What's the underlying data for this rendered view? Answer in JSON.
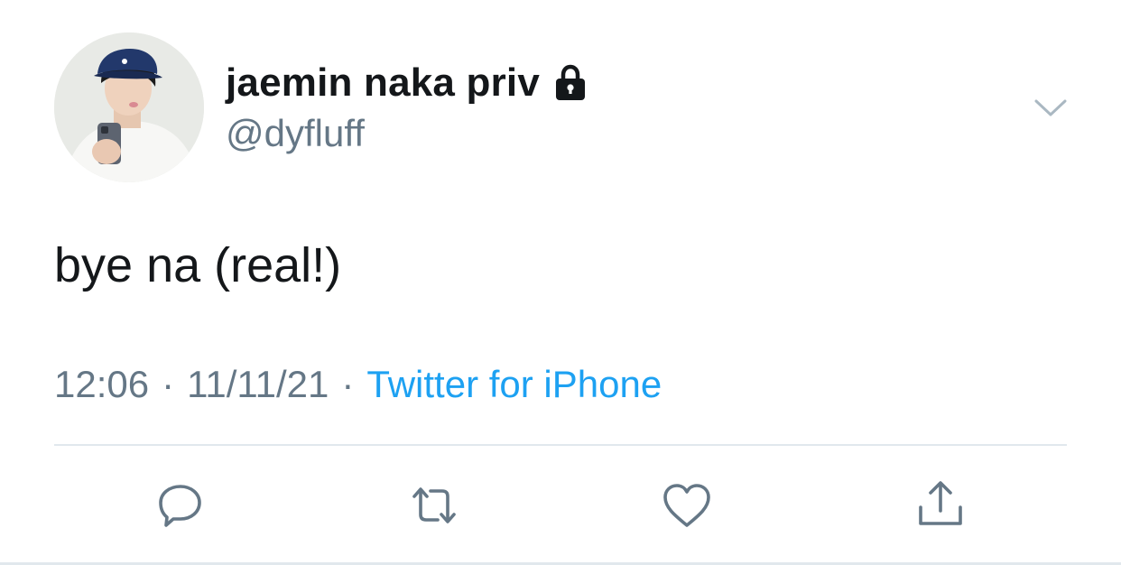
{
  "user": {
    "display_name": "jaemin naka priv",
    "handle": "@dyfluff",
    "avatar_icon": "profile-photo",
    "protected_icon": "lock-icon"
  },
  "tweet": {
    "text": "bye na (real!)",
    "time": "12:06",
    "date": "11/11/21",
    "separator": "·",
    "source": "Twitter for iPhone"
  },
  "actions": [
    {
      "name": "reply",
      "icon": "reply-icon"
    },
    {
      "name": "retweet",
      "icon": "retweet-icon"
    },
    {
      "name": "like",
      "icon": "heart-icon"
    },
    {
      "name": "share",
      "icon": "share-icon"
    }
  ],
  "colors": {
    "text": "#14171a",
    "secondary": "#657786",
    "link": "#1da1f2",
    "icon": "#657786",
    "divider": "#e1e8ed"
  }
}
